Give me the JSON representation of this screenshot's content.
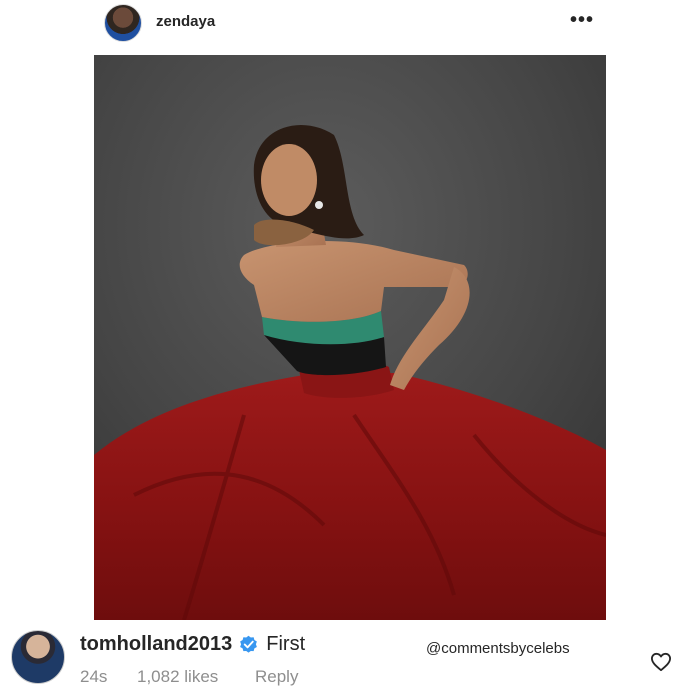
{
  "post": {
    "username": "zendaya",
    "more_icon": "more-horizontal-icon",
    "more_glyph": "•••"
  },
  "comment": {
    "username": "tomholland2013",
    "verified_icon": "verified-badge-icon",
    "text": "First",
    "time": "24s",
    "likes": "1,082 likes",
    "reply_label": "Reply",
    "like_icon": "heart-outline-icon"
  },
  "watermark": "@commentsbycelebs",
  "colors": {
    "verified": "#3897f0",
    "meta_text": "#8e8e8e",
    "dress_red": "#8e1414",
    "bodice_green": "#2f8a70"
  }
}
